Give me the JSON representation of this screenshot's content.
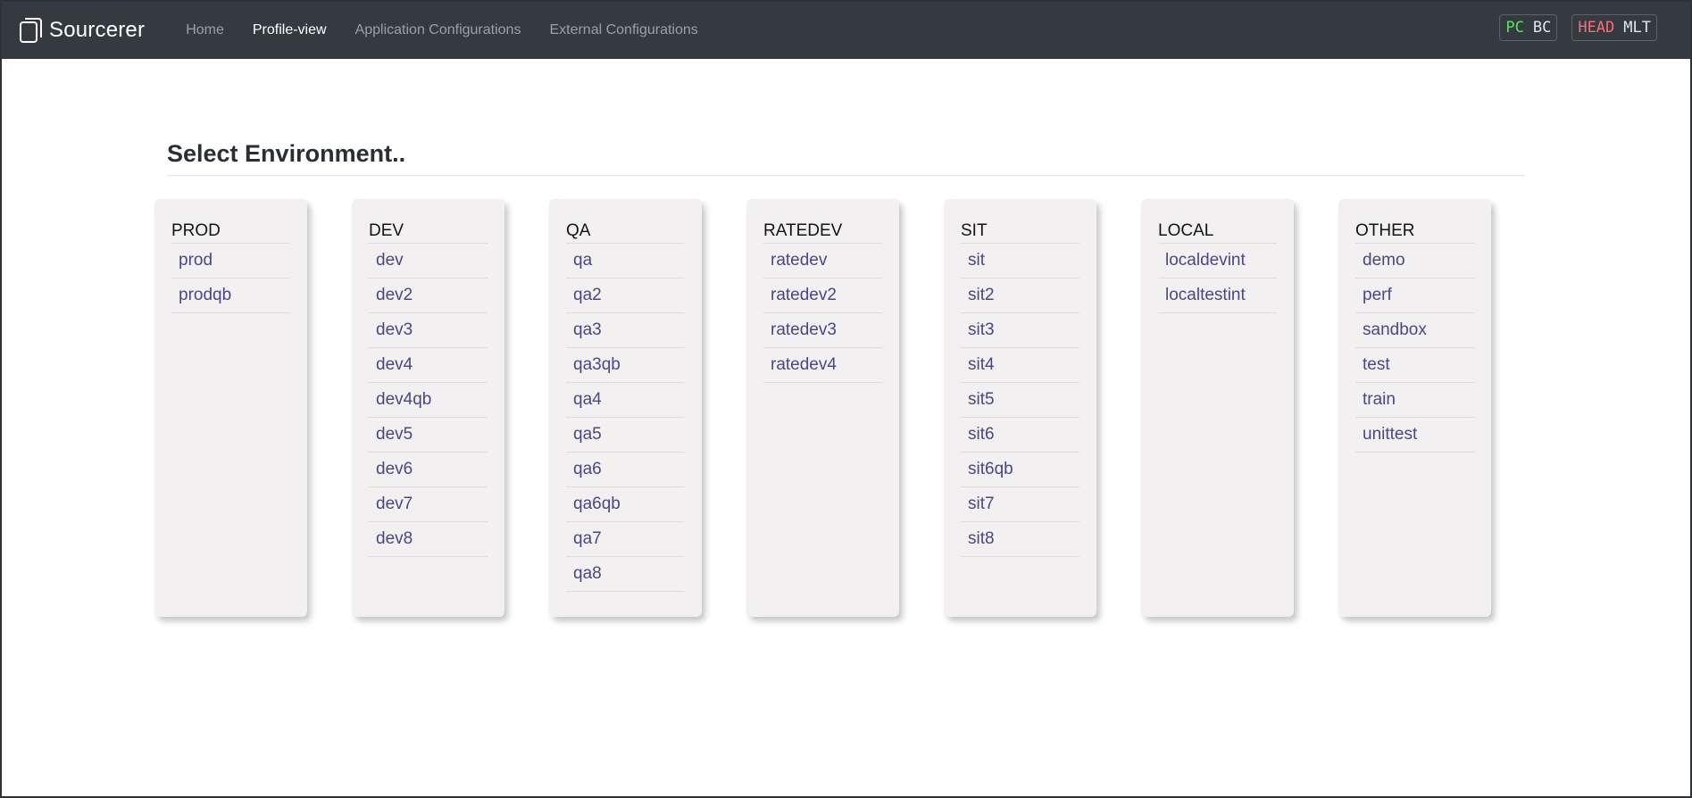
{
  "navbar": {
    "brand": "Sourcerer",
    "links": [
      {
        "label": "Home",
        "active": false
      },
      {
        "label": "Profile-view",
        "active": true
      },
      {
        "label": "Application Configurations",
        "active": false
      },
      {
        "label": "External Configurations",
        "active": false
      }
    ],
    "badges": [
      {
        "left": "PC",
        "left_color": "#5fdc6b",
        "right": "BC"
      },
      {
        "left": "HEAD",
        "left_color": "#ff6b75",
        "right": "MLT"
      }
    ]
  },
  "page": {
    "title": "Select Environment.."
  },
  "groups": [
    {
      "name": "PROD",
      "items": [
        "prod",
        "prodqb"
      ]
    },
    {
      "name": "DEV",
      "items": [
        "dev",
        "dev2",
        "dev3",
        "dev4",
        "dev4qb",
        "dev5",
        "dev6",
        "dev7",
        "dev8"
      ]
    },
    {
      "name": "QA",
      "items": [
        "qa",
        "qa2",
        "qa3",
        "qa3qb",
        "qa4",
        "qa5",
        "qa6",
        "qa6qb",
        "qa7",
        "qa8"
      ]
    },
    {
      "name": "RATEDEV",
      "items": [
        "ratedev",
        "ratedev2",
        "ratedev3",
        "ratedev4"
      ]
    },
    {
      "name": "SIT",
      "items": [
        "sit",
        "sit2",
        "sit3",
        "sit4",
        "sit5",
        "sit6",
        "sit6qb",
        "sit7",
        "sit8"
      ]
    },
    {
      "name": "LOCAL",
      "items": [
        "localdevint",
        "localtestint"
      ]
    },
    {
      "name": "OTHER",
      "items": [
        "demo",
        "perf",
        "sandbox",
        "test",
        "train",
        "unittest"
      ]
    }
  ],
  "colors": {
    "navbar_bg": "#343a40",
    "card_bg": "#f2f0f1",
    "link_color": "#4b4785"
  }
}
